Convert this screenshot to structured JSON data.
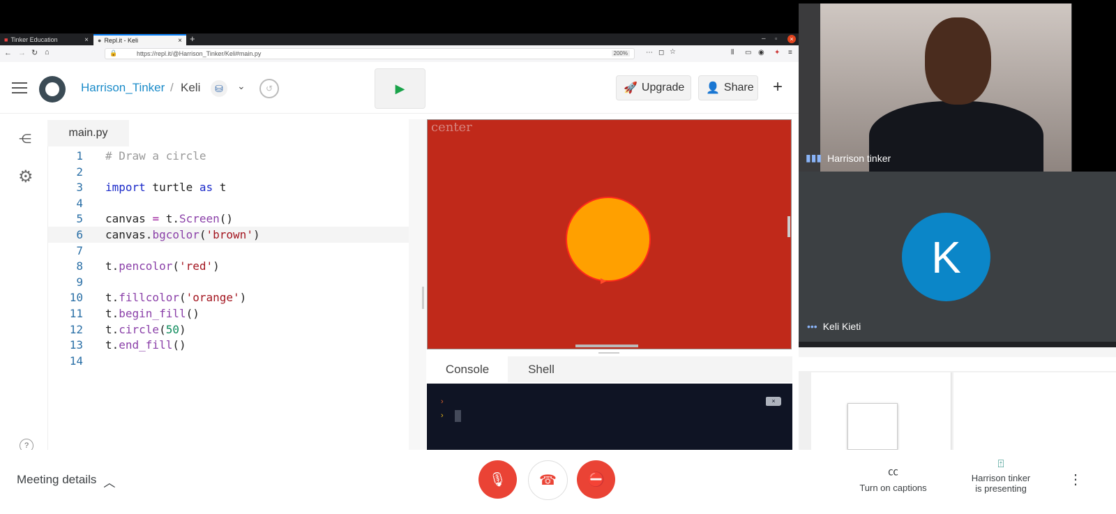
{
  "browser": {
    "tabs": [
      {
        "label": "Tinker Education",
        "active": false
      },
      {
        "label": "Repl.it - Keli",
        "active": true
      }
    ],
    "url": "https://repl.it/@Harrison_Tinker/Keli#main.py",
    "zoom": "200%"
  },
  "repl": {
    "owner": "Harrison_Tinker",
    "separator": "/",
    "name": "Keli",
    "upgrade_label": "Upgrade",
    "share_label": "Share",
    "file_tab": "main.py"
  },
  "code": {
    "current_line": 6,
    "lines": [
      {
        "n": "1",
        "html": "<span class='cm'># Draw a circle</span>"
      },
      {
        "n": "2",
        "html": ""
      },
      {
        "n": "3",
        "html": "<span class='kw'>import</span> turtle <span class='kw'>as</span> t"
      },
      {
        "n": "4",
        "html": ""
      },
      {
        "n": "5",
        "html": "canvas <span class='op'>=</span> t.<span class='fn'>Screen</span>()"
      },
      {
        "n": "6",
        "html": "canvas.<span class='fn'>bgcolor</span>(<span class='str'>'brown'</span>)"
      },
      {
        "n": "7",
        "html": ""
      },
      {
        "n": "8",
        "html": "t.<span class='fn'>pencolor</span>(<span class='str'>'red'</span>)"
      },
      {
        "n": "9",
        "html": ""
      },
      {
        "n": "10",
        "html": "t.<span class='fn'>fillcolor</span>(<span class='str'>'orange'</span>)"
      },
      {
        "n": "11",
        "html": "t.<span class='fn'>begin_fill</span>()"
      },
      {
        "n": "12",
        "html": "t.<span class='fn'>circle</span>(<span class='num'>50</span>)"
      },
      {
        "n": "13",
        "html": "t.<span class='fn'>end_fill</span>()"
      },
      {
        "n": "14",
        "html": ""
      }
    ]
  },
  "canvas": {
    "label": "center",
    "bg_color": "#c0291a",
    "fill_color": "#ffa000",
    "pen_color": "#ff2a1a"
  },
  "console_tabs": {
    "console": "Console",
    "shell": "Shell"
  },
  "meet": {
    "participant1": "Harrison tinker",
    "participant2": "Keli Kieti",
    "avatar_letter": "K",
    "meeting_details": "Meeting details",
    "captions": "Turn on captions",
    "presenting_line1": "Harrison tinker",
    "presenting_line2": "is presenting",
    "accent": "#ea4335"
  }
}
